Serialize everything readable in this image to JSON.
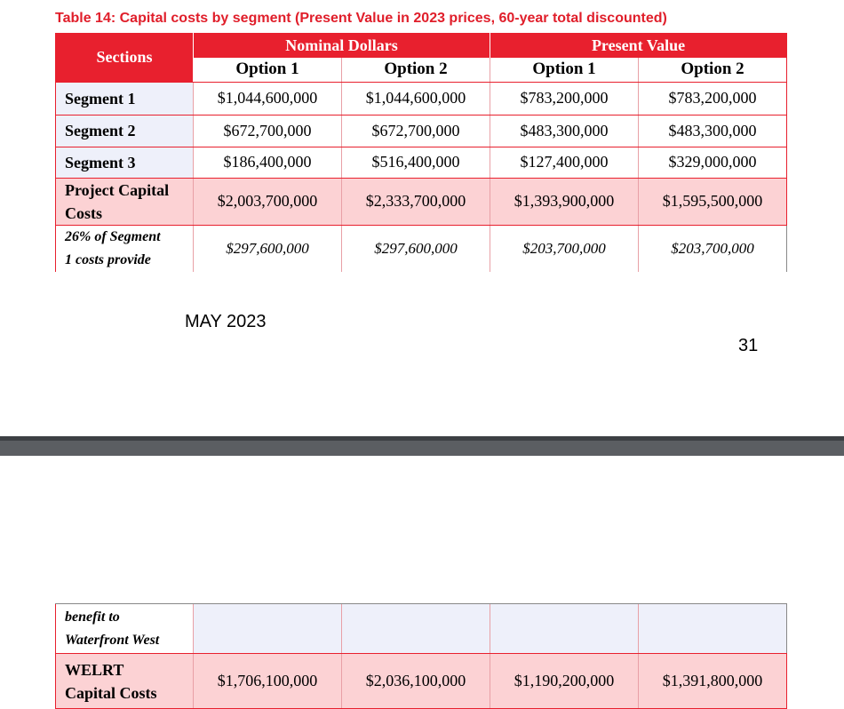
{
  "caption": "Table 14: Capital costs by segment (Present Value in 2023 prices, 60-year total discounted)",
  "header": {
    "sections": "Sections",
    "nominal": "Nominal Dollars",
    "present": "Present Value",
    "opt1": "Option 1",
    "opt2": "Option 2"
  },
  "rows": [
    {
      "label": "Segment 1",
      "values": [
        "$1,044,600,000",
        "$1,044,600,000",
        "$783,200,000",
        "$783,200,000"
      ]
    },
    {
      "label": "Segment 2",
      "values": [
        "$672,700,000",
        "$672,700,000",
        "$483,300,000",
        "$483,300,000"
      ]
    },
    {
      "label": "Segment 3",
      "values": [
        "$186,400,000",
        "$516,400,000",
        "$127,400,000",
        "$329,000,000"
      ]
    },
    {
      "label_line1": "Project Capital",
      "label_line2": "Costs",
      "values": [
        "$2,003,700,000",
        "$2,333,700,000",
        "$1,393,900,000",
        "$1,595,500,000"
      ]
    },
    {
      "label_line1": "26% of Segment",
      "label_line2": "1 costs provide",
      "values": [
        "$297,600,000",
        "$297,600,000",
        "$203,700,000",
        "$203,700,000"
      ]
    }
  ],
  "continued": {
    "label_line1": "benefit to",
    "label_line2": "Waterfront West"
  },
  "welrt": {
    "label_line1": "WELRT",
    "label_line2": "Capital Costs",
    "values": [
      "$1,706,100,000",
      "$2,036,100,000",
      "$1,190,200,000",
      "$1,391,800,000"
    ]
  },
  "footer": {
    "date": "MAY 2023",
    "page": "31"
  },
  "colors": {
    "header_red": "#e8202e",
    "total_row_pink": "#fcd2d4",
    "caption_red": "#e01e2a"
  }
}
